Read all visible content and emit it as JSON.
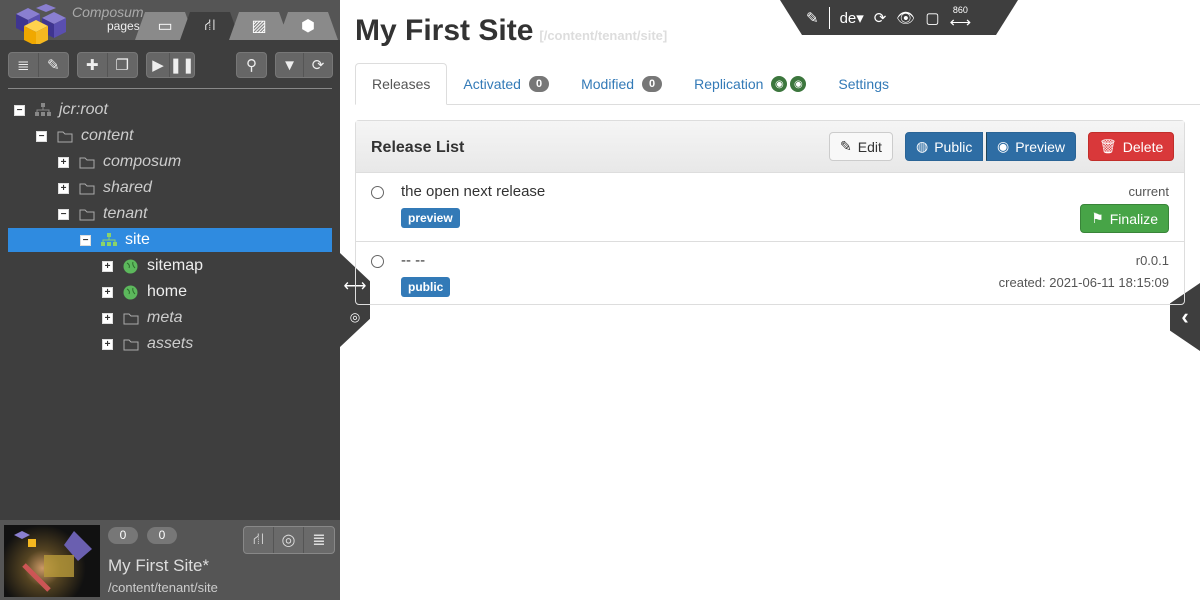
{
  "brand": {
    "line1": "Composum",
    "line2": "pages"
  },
  "nav_tabs": [
    {
      "icon": "inbox-icon"
    },
    {
      "icon": "sitemap-icon",
      "active": true
    },
    {
      "icon": "image-icon"
    },
    {
      "icon": "cube-icon"
    }
  ],
  "tree": [
    {
      "label": "jcr:root",
      "level": 0,
      "toggle": "−",
      "icon": "sitemap"
    },
    {
      "label": "content",
      "level": 1,
      "toggle": "−",
      "icon": "folder"
    },
    {
      "label": "composum",
      "level": 2,
      "toggle": "+",
      "icon": "folder"
    },
    {
      "label": "shared",
      "level": 2,
      "toggle": "+",
      "icon": "folder"
    },
    {
      "label": "tenant",
      "level": 2,
      "toggle": "−",
      "icon": "folder"
    },
    {
      "label": "site",
      "level": 3,
      "toggle": "−",
      "icon": "site",
      "selected": true
    },
    {
      "label": "sitemap",
      "level": 4,
      "toggle": "+",
      "icon": "globe"
    },
    {
      "label": "home",
      "level": 4,
      "toggle": "+",
      "icon": "globe"
    },
    {
      "label": "meta",
      "level": 4,
      "toggle": "+",
      "icon": "folder"
    },
    {
      "label": "assets",
      "level": 4,
      "toggle": "+",
      "icon": "folder"
    }
  ],
  "bottom": {
    "count1": "0",
    "count2": "0",
    "title": "My First Site*",
    "path": "/content/tenant/site"
  },
  "topbar": {
    "language": "de",
    "width": "860"
  },
  "page": {
    "title": "My First Site",
    "path": "[/content/tenant/site]"
  },
  "tabs": {
    "releases": "Releases",
    "activated": "Activated",
    "activated_count": "0",
    "modified": "Modified",
    "modified_count": "0",
    "replication": "Replication",
    "settings": "Settings"
  },
  "panel": {
    "title": "Release List",
    "edit": "Edit",
    "public": "Public",
    "preview": "Preview",
    "delete": "Delete",
    "finalize": "Finalize"
  },
  "releases": [
    {
      "title": "the open next release",
      "label": "preview",
      "right1": "current"
    },
    {
      "title": "-- --",
      "label": "public",
      "right1": "r0.0.1",
      "right2": "created: 2021-06-11 18:15:09"
    }
  ],
  "colors": {
    "primary": "#2e6da4",
    "danger": "#d9383a",
    "success": "#47a447",
    "selected": "#2f8be0"
  }
}
